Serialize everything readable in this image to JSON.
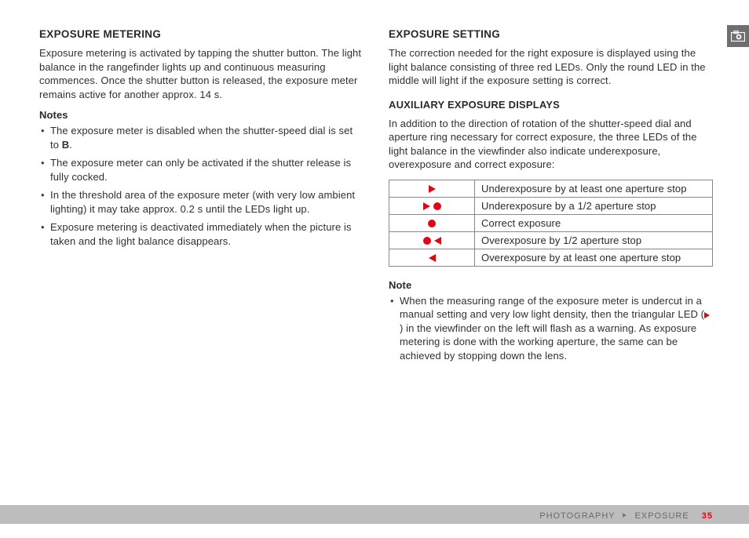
{
  "left": {
    "heading": "EXPOSURE METERING",
    "intro": "Exposure metering is activated by tapping the shutter button. The light balance in the rangefinder lights up and continuous measuring commences. Once the shutter button is released, the exposure meter remains active for another approx. 14 s.",
    "notesLabel": "Notes",
    "notes": {
      "n0a": "The exposure meter is disabled when the shutter-speed dial is set to ",
      "n0b": "B",
      "n0c": ".",
      "n1": "The exposure meter can only be activated if the shutter release is fully cocked.",
      "n2": "In the threshold area of the exposure meter (with very low ambient lighting) it may take approx. 0.2 s until the LEDs light up.",
      "n3": "Exposure metering is deactivated immediately when the picture is taken and the light balance disappears."
    }
  },
  "right": {
    "heading": "EXPOSURE SETTING",
    "intro": "The correction needed for the right exposure is displayed using the light balance consisting of three red LEDs. Only the round LED in the middle will light if the exposure setting is correct.",
    "sub": "AUXILIARY EXPOSURE DISPLAYS",
    "subIntro": "In addition to the direction of rotation of the shutter-speed dial and aperture ring necessary for correct exposure, the three LEDs of the light balance in the viewfinder also indicate underexposure, overexposure and correct exposure:",
    "table": {
      "r0": "Underexposure by at least one aperture stop",
      "r1": "Underexposure by a 1/2 aperture stop",
      "r2": "Correct exposure",
      "r3": "Overexposure by 1/2 aperture stop",
      "r4": "Overexposure by at least one aperture stop"
    },
    "noteLabel": "Note",
    "note_a": "When the measuring range of the exposure meter is undercut in a manual setting and very low light density, then the triangular LED (",
    "note_b": ") in the viewfinder on the left will flash as a warning. As exposure metering is done with the working aperture, the same can be achieved by stopping down the lens."
  },
  "footer": {
    "crumb1": "PHOTOGRAPHY",
    "crumb2": "EXPOSURE",
    "page": "35"
  }
}
